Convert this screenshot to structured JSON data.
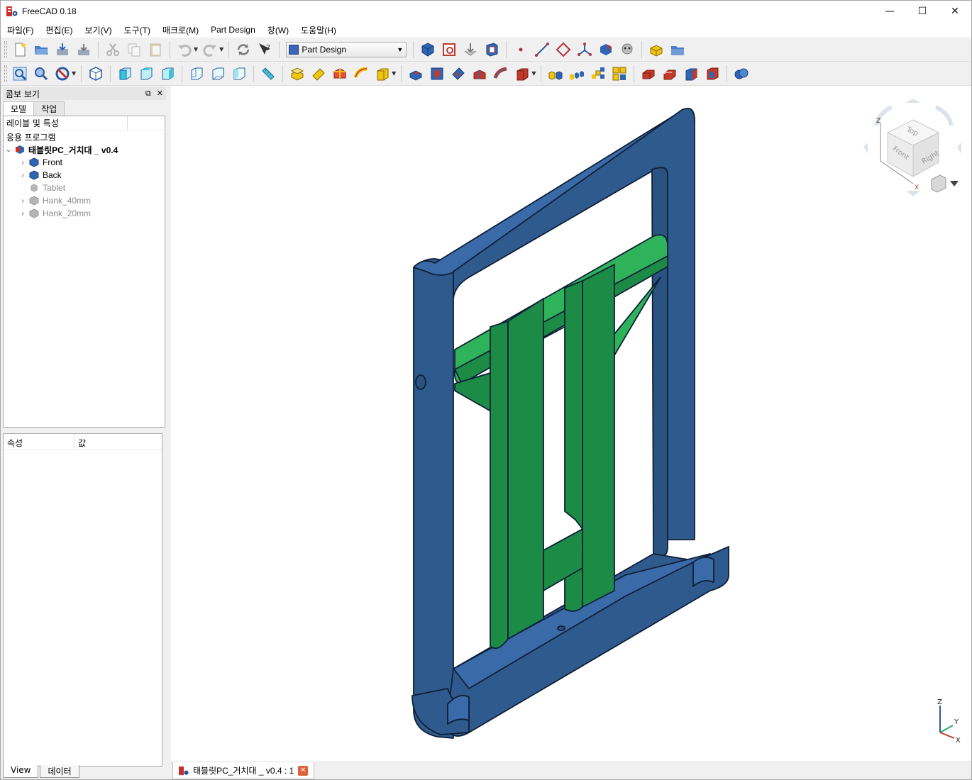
{
  "window": {
    "title": "FreeCAD 0.18",
    "controls": {
      "minimize": "—",
      "maximize": "☐",
      "close": "✕"
    }
  },
  "menu": [
    "파일(F)",
    "편집(E)",
    "보기(V)",
    "도구(T)",
    "매크로(M)",
    "Part Design",
    "창(W)",
    "도움말(H)"
  ],
  "workbench_selector": {
    "selected": "Part Design"
  },
  "combo_view": {
    "title": "콤보 보기",
    "tabs": [
      "모델",
      "작업"
    ],
    "tree_header": "레이블 및 특성",
    "app_label": "응용 프로그램",
    "tree_items": [
      {
        "label": "태블릿PC_거치대 _ v0.4",
        "icon": "document-icon",
        "expanded": true
      },
      {
        "label": "Front",
        "icon": "body-icon",
        "visible": true
      },
      {
        "label": "Back",
        "icon": "body-icon",
        "visible": true
      },
      {
        "label": "Tablet",
        "icon": "part-icon",
        "visible": false
      },
      {
        "label": "Hank_40mm",
        "icon": "body-icon",
        "visible": false
      },
      {
        "label": "Hank_20mm",
        "icon": "body-icon",
        "visible": false
      }
    ],
    "property_columns": [
      "속성",
      "값"
    ],
    "bottom_tabs": [
      "View",
      "데이터"
    ]
  },
  "navcube": {
    "faces": [
      "Top",
      "Front",
      "Right"
    ],
    "axis_labels": [
      "Z",
      "X"
    ]
  },
  "axis_indicator": {
    "labels": [
      "Z",
      "Y",
      "X"
    ]
  },
  "document_tab": {
    "label": "태블릿PC_거치대 _ v0.4 : 1"
  },
  "colors": {
    "blue_part": "#2f5a8e",
    "blue_part_light": "#3a6aa8",
    "green_part": "#1b8b45",
    "green_part_light": "#2fb35a",
    "background": "#ffffff"
  }
}
